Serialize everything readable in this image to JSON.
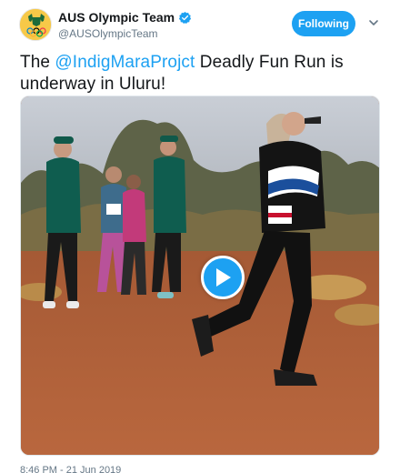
{
  "account": {
    "display_name": "AUS Olympic Team",
    "handle": "@AUSOlympicTeam",
    "avatar_icon": "coat-of-arms-olympic-rings-icon",
    "verified_icon": "verified-badge-icon"
  },
  "follow_button": {
    "label": "Following"
  },
  "menu": {
    "icon": "chevron-down-icon"
  },
  "tweet": {
    "prefix": "The ",
    "mention": "@IndigMaraProjct",
    "suffix": " Deadly Fun Run is underway in Uluru!"
  },
  "media": {
    "type": "video",
    "play_icon": "play-icon"
  },
  "timestamp": "8:46 PM - 21 Jun 2019",
  "colors": {
    "brand_blue": "#1da1f2",
    "text": "#14171a",
    "secondary_text": "#657786",
    "avatar_gold": "#f7c948",
    "uniform_green": "#0f5d4f"
  }
}
